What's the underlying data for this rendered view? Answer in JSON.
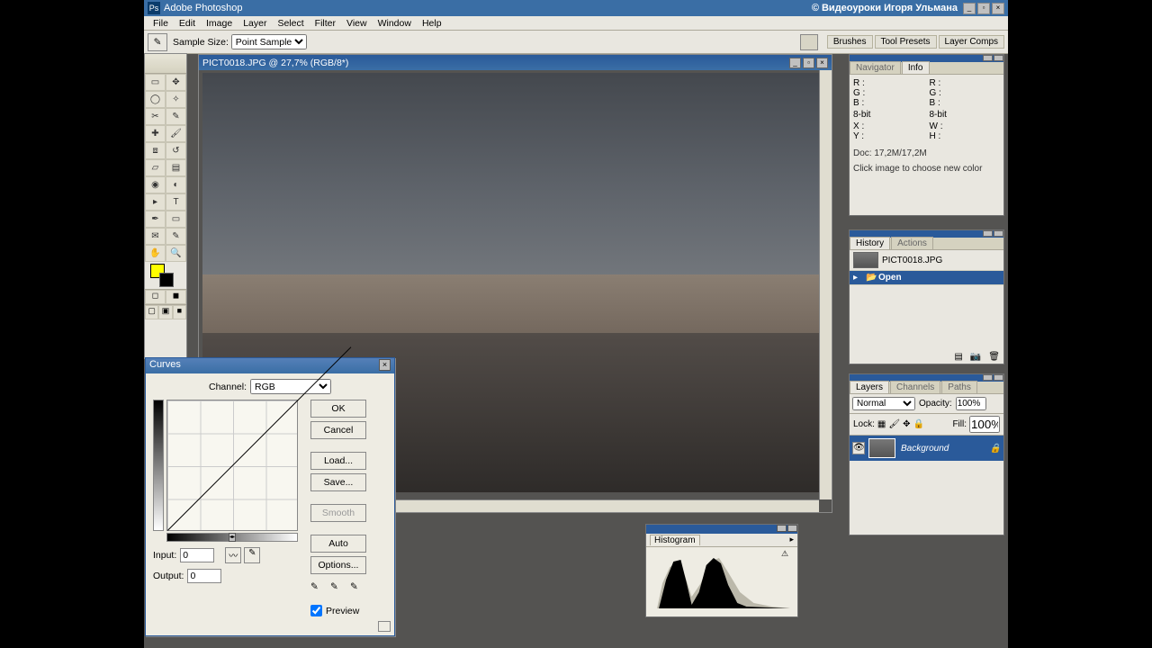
{
  "titlebar": {
    "app": "Adobe Photoshop",
    "credit": "© Видеоуроки Игоря Ульмана"
  },
  "menu": [
    "File",
    "Edit",
    "Image",
    "Layer",
    "Select",
    "Filter",
    "View",
    "Window",
    "Help"
  ],
  "options": {
    "sample_label": "Sample Size:",
    "sample_value": "Point Sample",
    "right_tabs": [
      "Brushes",
      "Tool Presets",
      "Layer Comps"
    ]
  },
  "document": {
    "title": "PICT0018.JPG @ 27,7% (RGB/8*)"
  },
  "info": {
    "tabs": [
      "Navigator",
      "Info"
    ],
    "rgb": {
      "R": "R :",
      "G": "G :",
      "B": "B :"
    },
    "bit": "8-bit",
    "xy": {
      "X": "X :",
      "Y": "Y :"
    },
    "wh": {
      "W": "W :",
      "H": "H :"
    },
    "doc": "Doc: 17,2M/17,2M",
    "hint": "Click image to choose new color"
  },
  "history": {
    "tabs": [
      "History",
      "Actions"
    ],
    "snapshot": "PICT0018.JPG",
    "step": "Open"
  },
  "layers": {
    "tabs": [
      "Layers",
      "Channels",
      "Paths"
    ],
    "blend": "Normal",
    "opacity_label": "Opacity:",
    "opacity": "100%",
    "lock_label": "Lock:",
    "fill_label": "Fill:",
    "fill": "100%",
    "layer_name": "Background"
  },
  "curves": {
    "title": "Curves",
    "channel_label": "Channel:",
    "channel": "RGB",
    "ok": "OK",
    "cancel": "Cancel",
    "load": "Load...",
    "save": "Save...",
    "smooth": "Smooth",
    "auto": "Auto",
    "options": "Options...",
    "input_label": "Input:",
    "input": "0",
    "output_label": "Output:",
    "output": "0",
    "preview": "Preview"
  },
  "histogram": {
    "tab": "Histogram"
  }
}
